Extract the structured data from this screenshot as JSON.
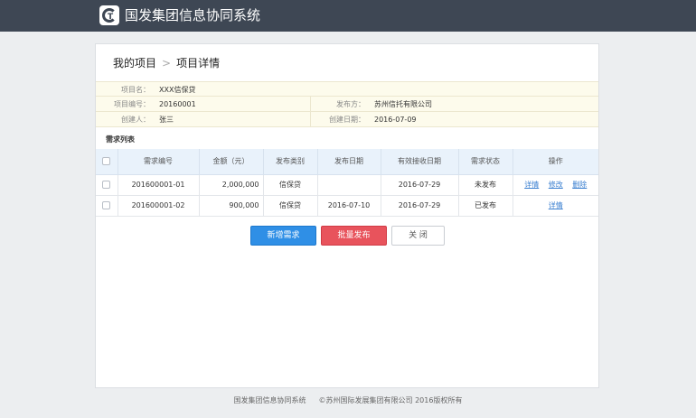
{
  "app": {
    "title": "国发集团信息协同系统",
    "logo_text": "G"
  },
  "breadcrumb": {
    "root": "我的项目",
    "separator": ">",
    "current": "项目详情"
  },
  "project": {
    "name_label": "项目名：",
    "name": "XXX信保贷",
    "code_label": "项目编号：",
    "code": "20160001",
    "publisher_label": "发布方：",
    "publisher": "苏州信托有限公司",
    "creator_label": "创建人：",
    "creator": "张三",
    "created_label": "创建日期：",
    "created": "2016-07-09"
  },
  "demand_list": {
    "title": "需求列表",
    "columns": [
      "需求编号",
      "金额（元）",
      "发布类别",
      "发布日期",
      "有效接收日期",
      "需求状态",
      "操作"
    ],
    "rows": [
      {
        "id": "201600001-01",
        "amount": "2,000,000",
        "category": "信保贷",
        "publish_date": "",
        "valid_date": "2016-07-29",
        "status": "未发布",
        "actions": [
          "详情",
          "修改",
          "删除"
        ]
      },
      {
        "id": "201600001-02",
        "amount": "900,000",
        "category": "信保贷",
        "publish_date": "2016-07-10",
        "valid_date": "2016-07-29",
        "status": "已发布",
        "actions": [
          "详情"
        ]
      }
    ]
  },
  "buttons": {
    "add": "新增需求",
    "batch_publish": "批量发布",
    "close": "关 闭"
  },
  "footer": {
    "system": "国发集团信息协同系统",
    "copyright": "©苏州国际发展集团有限公司 2016版权所有"
  },
  "colors": {
    "header_bg": "#3e4754",
    "primary": "#2f8fe6",
    "danger": "#e8535c",
    "info_bg": "#fdfbec",
    "table_header_bg": "#e9f2fb",
    "link": "#3a7fd0"
  }
}
